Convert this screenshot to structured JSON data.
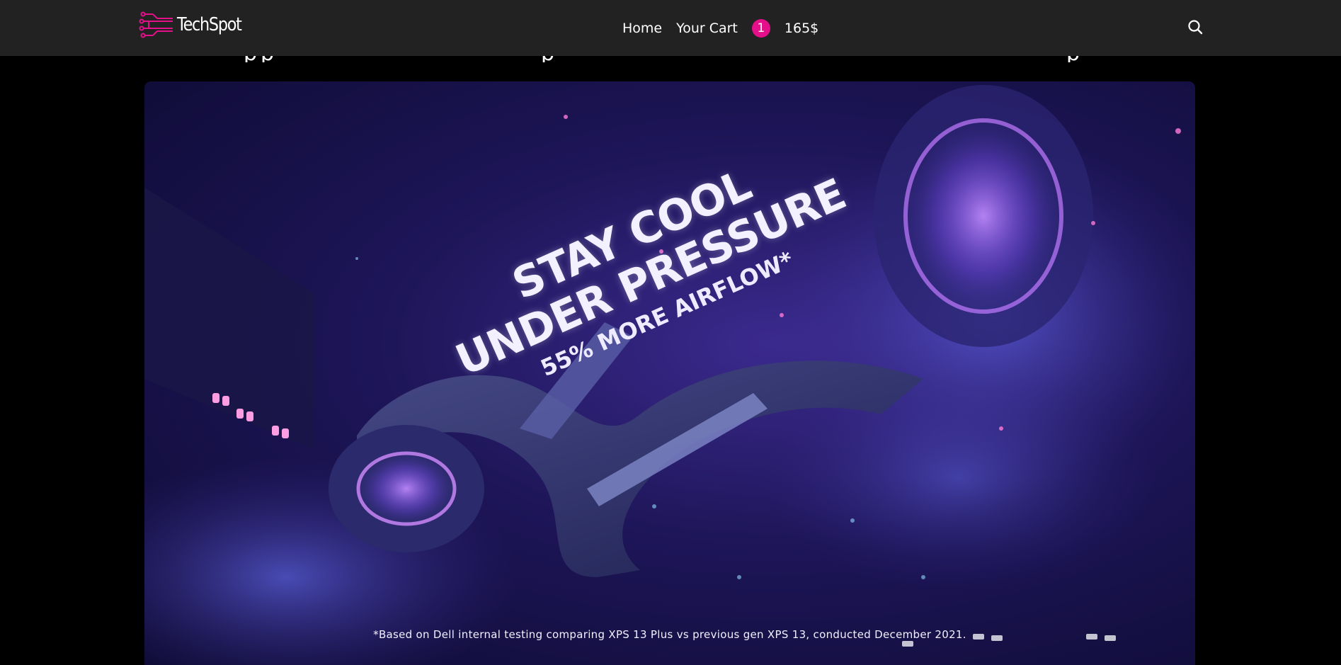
{
  "header": {
    "logo_text": "TechSpot",
    "nav": {
      "home": "Home",
      "cart": "Your Cart"
    },
    "cart_count": "1",
    "cart_total": "165$"
  },
  "banner": {
    "headline_line1": "STAY COOL",
    "headline_line2": "UNDER PRESSURE",
    "headline_line3": "55% MORE AIRFLOW*",
    "disclaimer": "*Based on Dell internal testing comparing XPS 13 Plus vs previous gen XPS 13, conducted December 2021."
  },
  "colors": {
    "accent": "#e3108a",
    "navbar": "#222222",
    "background": "#000000"
  }
}
